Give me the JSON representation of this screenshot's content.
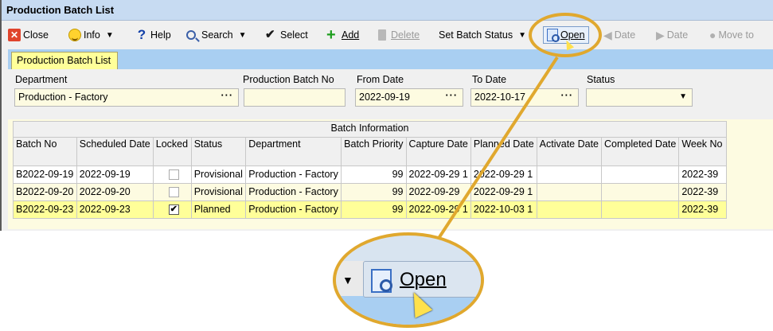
{
  "window": {
    "title": "Production Batch List"
  },
  "toolbar": {
    "close": "Close",
    "info": "Info",
    "help": "Help",
    "search": "Search",
    "select": "Select",
    "add": "Add",
    "delete": "Delete",
    "set_batch_status": "Set Batch Status",
    "open": "Open",
    "date_prev": "Date",
    "date_next": "Date",
    "move_to": "Move to"
  },
  "tab": {
    "label": "Production Batch List"
  },
  "filters": {
    "department": {
      "label": "Department",
      "value": "Production - Factory"
    },
    "batch_no": {
      "label": "Production Batch No",
      "value": ""
    },
    "from_date": {
      "label": "From Date",
      "value": "2022-09-19"
    },
    "to_date": {
      "label": "To Date",
      "value": "2022-10-17"
    },
    "status": {
      "label": "Status",
      "value": ""
    }
  },
  "grid": {
    "group_header": "Batch Information",
    "columns": [
      "Batch No",
      "Scheduled Date",
      "Locked",
      "Status",
      "Department",
      "Batch Priority",
      "Capture Date",
      "Planned Date",
      "Activate Date",
      "Completed Date",
      "Week No"
    ],
    "rows": [
      {
        "batch_no": "B2022-09-19",
        "scheduled": "2022-09-19",
        "locked": "",
        "status": "Provisional",
        "department": "Production - Factory",
        "priority": "99",
        "capture": "2022-09-29 1",
        "planned": "2022-09-29 1",
        "activate": "",
        "completed": "",
        "week": "2022-39"
      },
      {
        "batch_no": "B2022-09-20",
        "scheduled": "2022-09-20",
        "locked": "",
        "status": "Provisional",
        "department": "Production - Factory",
        "priority": "99",
        "capture": "2022-09-29",
        "planned": "2022-09-29 1",
        "activate": "",
        "completed": "",
        "week": "2022-39"
      },
      {
        "batch_no": "B2022-09-23",
        "scheduled": "2022-09-23",
        "locked": "✔",
        "status": "Planned",
        "department": "Production - Factory",
        "priority": "99",
        "capture": "2022-09-29 1",
        "planned": "2022-10-03 1",
        "activate": "",
        "completed": "",
        "week": "2022-39"
      }
    ]
  },
  "zoom": {
    "open_label": "Open"
  },
  "colors": {
    "highlight": "#e0a82e",
    "tab_strip": "#a9cff2",
    "selected_row": "#ffff99"
  }
}
